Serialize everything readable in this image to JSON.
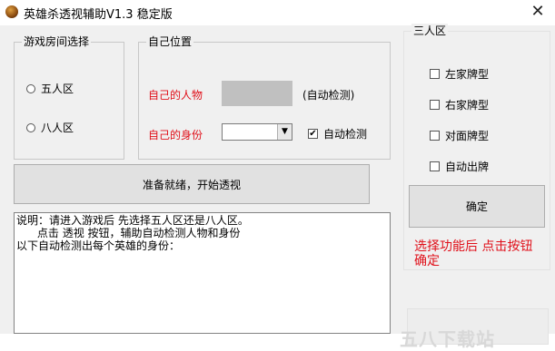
{
  "window": {
    "title": "英雄杀透视辅助V1.3 稳定版",
    "close_glyph": "✕",
    "app_icon": "game-icon"
  },
  "room_group": {
    "title": "游戏房间选择",
    "options": [
      "五人区",
      "八人区"
    ]
  },
  "position_group": {
    "title": "自己位置",
    "character_label": "自己的人物",
    "auto_detect_text": "(自动检测)",
    "identity_label": "自己的身份",
    "identity_value": "",
    "auto_detect_checkbox": "自动检测",
    "auto_detect_checked": true,
    "check_glyph": "✔"
  },
  "start_button": "准备就绪，开始透视",
  "instructions": {
    "line1": "说明：请进入游戏后 先选择五人区还是八人区。",
    "line2": "      点击 透视 按钮，辅助自动检测人物和身份",
    "line3": "",
    "line4": "以下自动检测出每个英雄的身份："
  },
  "three_group": {
    "title": "三人区",
    "options": [
      {
        "label": "左家牌型",
        "checked": false
      },
      {
        "label": "右家牌型",
        "checked": false
      },
      {
        "label": "对面牌型",
        "checked": false
      },
      {
        "label": "自动出牌",
        "checked": false
      }
    ],
    "confirm_button": "确定",
    "hint": "选择功能后 点击按钮确定"
  },
  "watermark": "五八下载站",
  "colors": {
    "accent_red": "#e0101a",
    "window_bg": "#f0f0f0"
  }
}
